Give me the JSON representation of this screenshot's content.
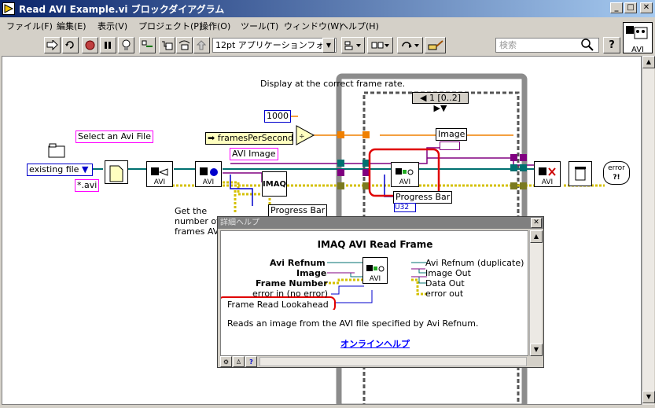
{
  "window": {
    "title": "Read AVI Example.vi ブロックダイアグラム",
    "controls": {
      "minimize": "_",
      "maximize": "□",
      "close": "✕"
    }
  },
  "menu": [
    "ファイル(F)",
    "編集(E)",
    "表示(V)",
    "プロジェクト(P)",
    "操作(O)",
    "ツール(T)",
    "ウィンドウ(W)",
    "ヘルプ(H)"
  ],
  "toolbar": {
    "font": "12pt アプリケーションフォント",
    "search_placeholder": "検索",
    "help_glyph": "?",
    "context_label": "AVI"
  },
  "diagram": {
    "comments": {
      "display_rate": "Display at the correct frame rate.",
      "get_frames": "Get the number of frames AVI file."
    },
    "labels": {
      "select_file": "Select an Avi File",
      "avi_image": "AVI Image",
      "image": "Image",
      "progress_bar": "Progress Bar",
      "progress_bar_inner": "Progress Bar"
    },
    "constants": {
      "existing_file": "existing file",
      "avi_pattern": "*.avi",
      "thousand": "1000",
      "frames_per_second": "framesPerSecond",
      "case_selector": "1 [0..2]",
      "u32": "U32"
    },
    "nodes": {
      "avi": "AVI",
      "imaq": "IMAQ",
      "error": "error"
    }
  },
  "help": {
    "title": "詳細ヘルプ",
    "function": "IMAQ AVI Read Frame",
    "inputs": [
      "Avi Refnum",
      "Image",
      "Frame Number",
      "error in (no error)",
      "Frame Read Lookahead"
    ],
    "outputs": [
      "Avi Refnum (duplicate)",
      "Image Out",
      "Data Out",
      "error out"
    ],
    "description": "Reads an image from the AVI file specified by Avi Refnum.",
    "link": "オンラインヘルプ",
    "close": "✕"
  },
  "colors": {
    "title_start": "#0a246a",
    "title_end": "#a6caf0",
    "label_border": "#ff00ff",
    "highlight": "#e00000",
    "wire_refnum": "#007070",
    "wire_image": "#800080",
    "wire_error": "#d4c000",
    "loop_frame": "#8c8c8c",
    "link": "#0000ff"
  }
}
